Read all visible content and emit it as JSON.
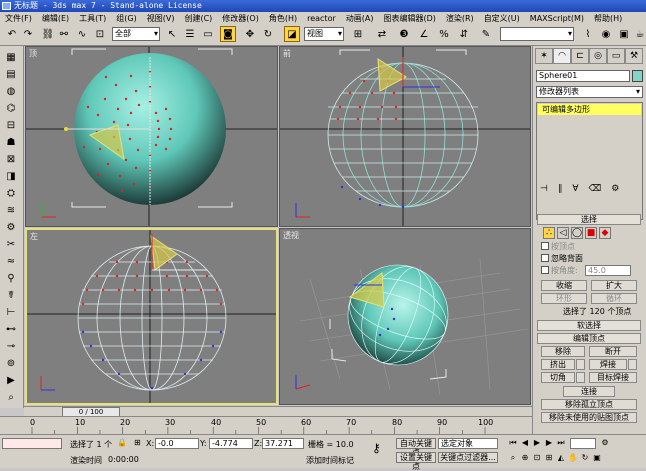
{
  "title": "无标题 - 3ds max 7 - Stand-alone License",
  "menu": [
    "文件(F)",
    "编辑(E)",
    "工具(T)",
    "组(G)",
    "视图(V)",
    "创建(C)",
    "修改器(O)",
    "角色(H)",
    "reactor",
    "动画(A)",
    "图表编辑器(D)",
    "渲染(R)",
    "自定义(U)",
    "MAXScript(M)",
    "帮助(H)"
  ],
  "toolbar": {
    "selection_filter": "全部",
    "ref_coord": "视图"
  },
  "viewports": {
    "top": "顶",
    "front": "前",
    "left": "左",
    "persp": "透视"
  },
  "command_panel": {
    "object_name": "Sphere01",
    "object_color": "#7fd6c8",
    "modifier_list": "修改器列表",
    "stack_item": "可编辑多边形",
    "selection_title": "选择",
    "by_vertex": "按顶点",
    "ignore_backfacing": "忽略背面",
    "by_angle": "按角度:",
    "angle_value": "45.0",
    "shrink": "收缩",
    "grow": "扩大",
    "ring": "环形",
    "loop": "循环",
    "selected_count": "选择了 120 个顶点",
    "soft_selection": "软选择",
    "edit_vertices": "编辑顶点",
    "remove": "移除",
    "break": "断开",
    "extrude": "挤出",
    "weld": "焊接",
    "chamfer": "切角",
    "target_weld": "目标焊接",
    "connect": "连接",
    "remove_isolated": "移除孤立顶点",
    "remove_unused_map": "移除未使用的贴图顶点"
  },
  "time": {
    "slider": "0 / 100",
    "ticks": [
      "0",
      "10",
      "20",
      "30",
      "40",
      "50",
      "60",
      "70",
      "80",
      "90",
      "100"
    ]
  },
  "status": {
    "selected": "选择了 1 个",
    "x_label": "X:",
    "x": "-0.0",
    "y_label": "Y:",
    "y": "-4.774",
    "z_label": "Z:",
    "z": "37.271",
    "grid": "栅格 = 10.0",
    "auto_key": "自动关键点",
    "selected_object": "选定对象",
    "set_key": "设置关键点",
    "key_filters": "关键点过滤器...",
    "render_time": "渲染时间",
    "render_time_value": "0:00:00",
    "add_time_tag": "添加时间标记"
  },
  "colors": {
    "sphere": "#5fc8b8",
    "viewport_bg": "#7f7f7f",
    "active_border": "#e8e078",
    "stack_highlight": "#ffff60"
  }
}
